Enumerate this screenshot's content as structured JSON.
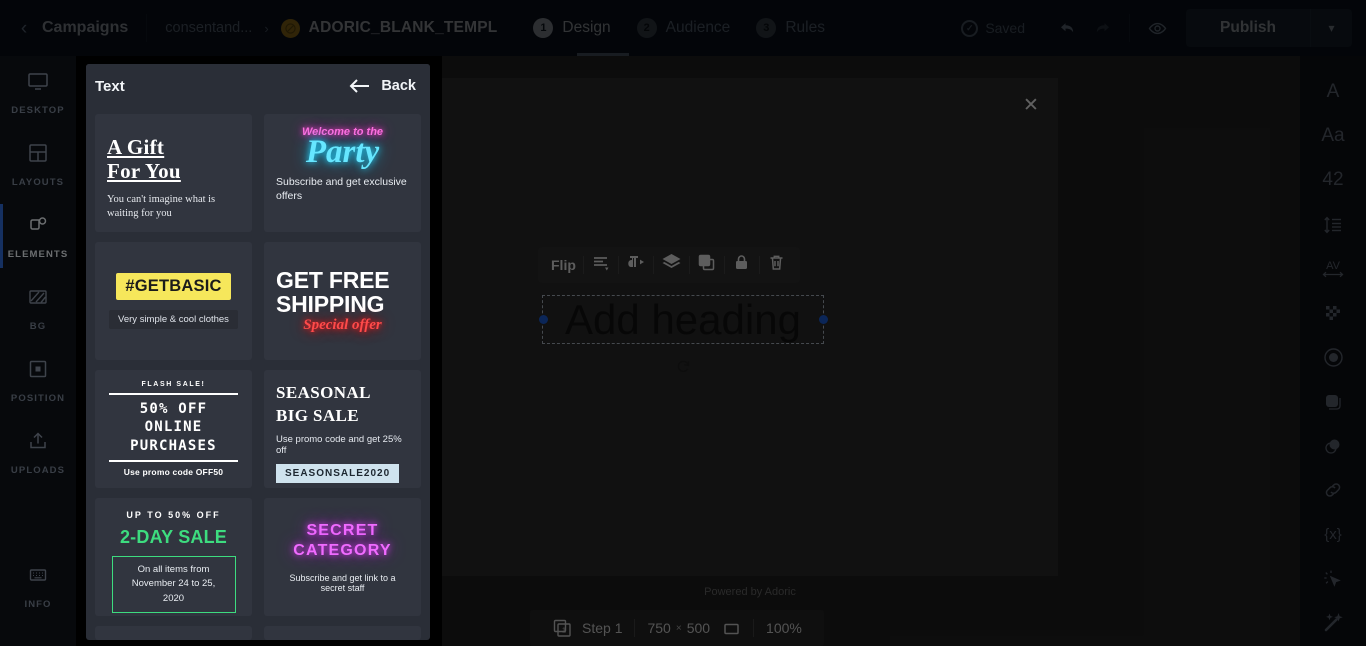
{
  "topbar": {
    "back_icon": "chevron-left-icon",
    "campaigns_label": "Campaigns",
    "breadcrumb_mid": "consentand...",
    "breadcrumb_sep": "›",
    "template_name": "ADORIC_BLANK_TEMPL",
    "steps": [
      {
        "num": "1",
        "label": "Design",
        "active": true
      },
      {
        "num": "2",
        "label": "Audience",
        "active": false
      },
      {
        "num": "3",
        "label": "Rules",
        "active": false
      }
    ],
    "saved_label": "Saved",
    "saved_icon": "check-circle-icon",
    "undo_icon": "undo-icon",
    "redo_icon": "redo-icon",
    "preview_icon": "eye-icon",
    "publish_label": "Publish",
    "publish_caret_icon": "chevron-down-icon"
  },
  "left_rail": [
    {
      "icon": "monitor-icon",
      "label": "DESKTOP",
      "active": false
    },
    {
      "icon": "layouts-icon",
      "label": "LAYOUTS",
      "active": false
    },
    {
      "icon": "elements-icon",
      "label": "ELEMENTS",
      "active": true
    },
    {
      "icon": "background-icon",
      "label": "BG",
      "active": false
    },
    {
      "icon": "position-icon",
      "label": "POSITION",
      "active": false
    },
    {
      "icon": "upload-icon",
      "label": "UPLOADS",
      "active": false
    },
    {
      "icon": "info-icon",
      "label": "INFO",
      "active": false
    }
  ],
  "panel": {
    "title": "Text",
    "back_label": "Back",
    "back_icon": "arrow-left-icon",
    "cards": [
      {
        "id": "a-gift-for-you",
        "title_line1": "A Gift",
        "title_line2": "For You",
        "sub": "You can't imagine what is waiting for you"
      },
      {
        "id": "welcome-to-the-party",
        "top": "Welcome to the",
        "main": "Party",
        "sub": "Subscribe and get exclusive offers",
        "top_color": "#ff6fe0",
        "main_color": "#66e6ff"
      },
      {
        "id": "getbasic",
        "tag": "#GETBASIC",
        "sub": "Very simple & cool clothes",
        "tag_bg": "#f6e75b"
      },
      {
        "id": "get-free-shipping",
        "line1": "GET FREE",
        "line2": "SHIPPING",
        "neon": "Special offer",
        "neon_color": "#ff4a4a"
      },
      {
        "id": "flash-sale-50-off",
        "kicker": "FLASH SALE!",
        "main_line1": "50% OFF",
        "main_line2": "ONLINE",
        "main_line3": "PURCHASES",
        "note": "Use promo code OFF50"
      },
      {
        "id": "seasonal-big-sale",
        "main_line1": "SEASONAL",
        "main_line2": "BIG SALE",
        "sub": "Use promo code and get 25% off",
        "code": "SEASONSALE2020",
        "code_bg": "#cfe3ee"
      },
      {
        "id": "2-day-sale",
        "kicker": "UP TO 50% OFF",
        "main": "2-DAY SALE",
        "box_line1": "On all items from",
        "box_line2": "November 24 to 25, 2020",
        "accent": "#3ddc7f"
      },
      {
        "id": "secret-category",
        "main_line1": "SECRET",
        "main_line2": "CATEGORY",
        "sub": "Subscribe and get link to a secret staff",
        "main_color": "#f06bff"
      }
    ]
  },
  "canvas": {
    "close_icon": "close-icon",
    "powered_by": "Powered by Adoric",
    "selected_element_text": "Add heading",
    "rotate_icon": "rotate-icon",
    "element_toolbar": [
      {
        "id": "flip",
        "label": "Flip",
        "icon": "flip-label"
      },
      {
        "id": "align",
        "label": "",
        "icon": "align-icon"
      },
      {
        "id": "text-direction",
        "label": "",
        "icon": "text-direction-icon"
      },
      {
        "id": "layers",
        "label": "",
        "icon": "layers-icon"
      },
      {
        "id": "duplicate",
        "label": "",
        "icon": "duplicate-icon"
      },
      {
        "id": "lock",
        "label": "",
        "icon": "lock-icon"
      },
      {
        "id": "delete",
        "label": "",
        "icon": "trash-icon"
      }
    ]
  },
  "bottombar": {
    "step_icon": "steps-icon",
    "step_label": "Step 1",
    "width": "750",
    "times": "×",
    "height": "500",
    "size_icon": "rectangle-icon",
    "zoom": "100%"
  },
  "right_rail": [
    {
      "id": "font-family",
      "glyph": "A",
      "icon": "font-icon"
    },
    {
      "id": "text-case",
      "glyph": "Aa",
      "icon": "text-case-icon"
    },
    {
      "id": "font-size",
      "glyph": "42",
      "icon": "font-size-icon"
    },
    {
      "id": "line-height",
      "glyph": "",
      "icon": "line-height-icon"
    },
    {
      "id": "letter-spacing",
      "glyph": "AV",
      "icon": "letter-spacing-icon"
    },
    {
      "id": "opacity",
      "glyph": "",
      "icon": "opacity-icon"
    },
    {
      "id": "text-color",
      "glyph": "",
      "icon": "color-circle-icon"
    },
    {
      "id": "background",
      "glyph": "",
      "icon": "rounded-square-icon"
    },
    {
      "id": "shadow",
      "glyph": "",
      "icon": "shadow-icon"
    },
    {
      "id": "link",
      "glyph": "",
      "icon": "link-icon"
    },
    {
      "id": "variable",
      "glyph": "{x}",
      "icon": "variable-icon"
    },
    {
      "id": "click-action",
      "glyph": "",
      "icon": "click-cursor-icon"
    },
    {
      "id": "effects",
      "glyph": "",
      "icon": "magic-wand-icon"
    }
  ],
  "colors": {
    "accent_blue": "#2f6bd8",
    "panel_bg": "#2a2e37",
    "card_bg": "#31353f",
    "topbar_bg": "#0e1a2b"
  }
}
